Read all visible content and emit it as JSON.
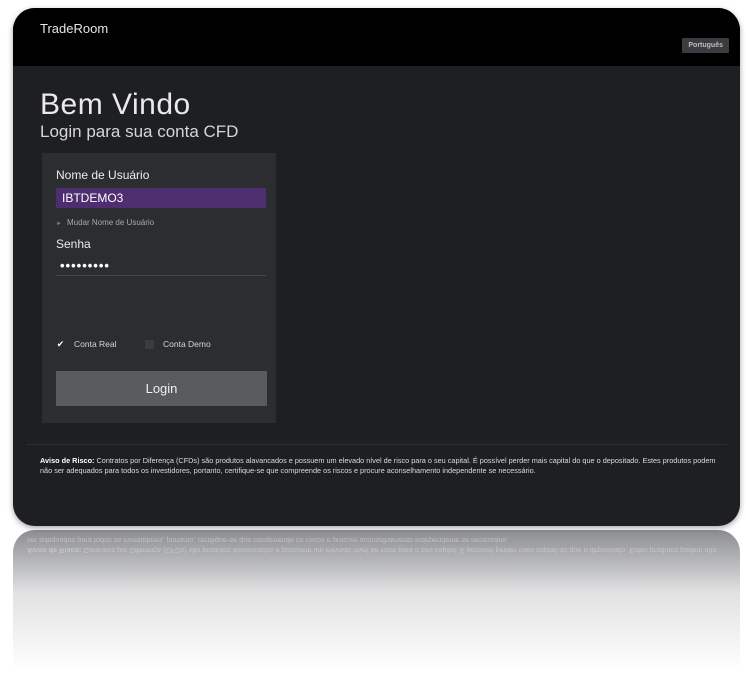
{
  "app": {
    "title": "TradeRoom",
    "language_button": "Português"
  },
  "welcome": {
    "title": "Bem Vindo",
    "subtitle": "Login para sua conta CFD"
  },
  "login_form": {
    "username_label": "Nome de Usuário",
    "username_value": "IBTDEMO3",
    "change_username_link": "Mudar Nome de Usuário",
    "password_label": "Senha",
    "password_value": "•••••••••",
    "account_real_label": "Conta Real",
    "account_real_checked": true,
    "account_demo_label": "Conta Demo",
    "account_demo_checked": false,
    "login_button": "Login"
  },
  "risk_warning": {
    "heading": "Aviso de Risco:",
    "text": " Contratos por Diferença (CFDs) são produtos alavancados e possuem um elevado nível de risco para o seu capital. É possível perder mais capital do que o depositado. Estes produtos podem não ser adequados para todos os investidores, portanto, certifique-se que compreende os riscos e procure aconselhamento independente se necessário."
  },
  "colors": {
    "topbar": "#000000",
    "background": "#1d1f23",
    "panel": "#2b2d31",
    "username_highlight": "#4e2e6e",
    "login_button": "#5a5b5f"
  },
  "icons": {
    "checkbox_checked": "checkmark-icon",
    "link_arrow": "triangle-right-icon"
  }
}
